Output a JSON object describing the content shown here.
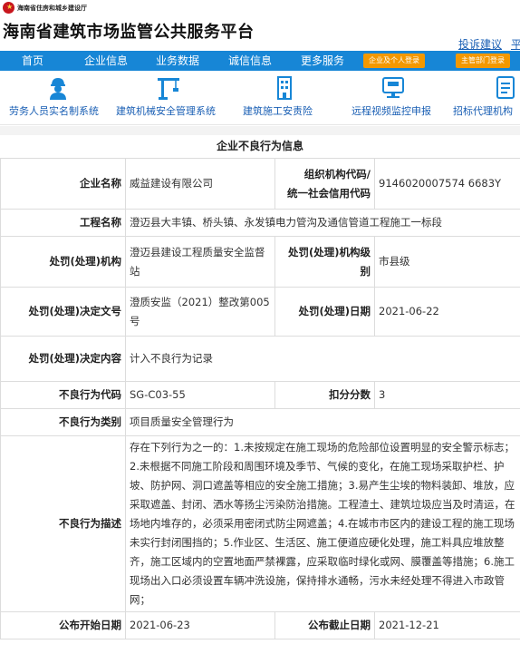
{
  "header": {
    "dept": "海南省住房和城乡建设厅",
    "title": "海南省建筑市场监管公共服务平台",
    "links": [
      "投诉建议",
      "平台"
    ]
  },
  "nav": {
    "items": [
      "首页",
      "企业信息",
      "业务数据",
      "诚信信息",
      "更多服务"
    ],
    "btn_enterprise": "企业及个人登录",
    "btn_dept": "主管部门登录"
  },
  "quick": {
    "items": [
      {
        "label": "劳务人员实名制系统",
        "icon": "worker-icon"
      },
      {
        "label": "建筑机械安全管理系统",
        "icon": "crane-icon"
      },
      {
        "label": "建筑施工安责险",
        "icon": "building-icon"
      },
      {
        "label": "远程视频监控申报",
        "icon": "monitor-icon"
      },
      {
        "label": "招标代理机构",
        "icon": "document-icon"
      }
    ]
  },
  "info": {
    "title": "企业不良行为信息",
    "company_label": "企业名称",
    "company": "威益建设有限公司",
    "org_code_label_1": "组织机构代码/",
    "org_code_label_2": "统一社会信用代码",
    "org_code": "9146020007574 6683Y",
    "project_label": "工程名称",
    "project": "澄迈县大丰镇、桥头镇、永发镇电力管沟及通信管道工程施工一标段",
    "penalty_org_label": "处罚(处理)机构",
    "penalty_org": "澄迈县建设工程质量安全监督站",
    "penalty_level_label": "处罚(处理)机构级别",
    "penalty_level": "市县级",
    "decision_no_label": "处罚(处理)决定文号",
    "decision_no": "澄质安监（2021）整改第005号",
    "decision_date_label": "处罚(处理)日期",
    "decision_date": "2021-06-22",
    "decision_content_label": "处罚(处理)决定内容",
    "decision_content": "计入不良行为记录",
    "behavior_code_label": "不良行为代码",
    "behavior_code": "SG-C03-55",
    "deduction_label": "扣分分数",
    "deduction": "3",
    "behavior_type_label": "不良行为类别",
    "behavior_type": "项目质量安全管理行为",
    "behavior_desc_label": "不良行为描述",
    "behavior_desc": "存在下列行为之一的：1.未按规定在施工现场的危险部位设置明显的安全警示标志；2.未根据不同施工阶段和周围环境及季节、气候的变化，在施工现场采取护栏、护坡、防护网、洞口遮盖等相应的安全施工措施；3.易产生尘埃的物料装卸、堆放，应采取遮盖、封闭、洒水等扬尘污染防治措施。工程渣土、建筑垃圾应当及时清运，在场地内堆存的，必须采用密闭式防尘网遮盖；4.在城市市区内的建设工程的施工现场未实行封闭围挡的；5.作业区、生活区、施工便道应硬化处理，施工料具应堆放整齐，施工区域内的空置地面严禁裸露，应采取临时绿化或网、膜覆盖等措施；6.施工现场出入口必须设置车辆冲洗设施，保持排水通畅，污水未经处理不得进入市政管网；",
    "start_date_label": "公布开始日期",
    "start_date": "2021-06-23",
    "end_date_label": "公布截止日期",
    "end_date": "2021-12-21"
  }
}
